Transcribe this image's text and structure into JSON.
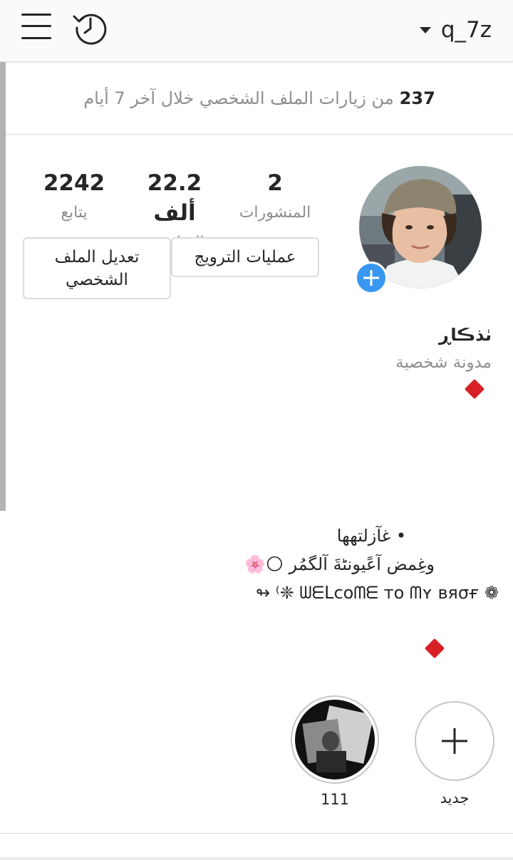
{
  "header": {
    "username": "q_7z",
    "menu_icon": "hamburger-menu-icon",
    "history_icon": "history-clock-icon",
    "dropdown_icon": "caret-down-icon"
  },
  "visits": {
    "count": "237",
    "text": "من زيارات الملف الشخصي خلال آخر 7 أيام"
  },
  "stats": {
    "posts": {
      "value": "2",
      "label": "المنشورات"
    },
    "followers": {
      "value": "22.2 ألف",
      "label": "المتابعون"
    },
    "following": {
      "value": "2242",
      "label": "يتابع"
    }
  },
  "buttons": {
    "promotions": "عمليات الترويج",
    "edit_profile_line1": "تعديل الملف",
    "edit_profile_line2": "الشخصي"
  },
  "bio": {
    "name": "ٺذڪاڕ",
    "category": "مدونة شخصية",
    "line1": "• غآزلتهها",
    "line2": "وغِمض آعًيونٹةَ آلگمُر 🌕🌸",
    "line3": "❁ ᗯᗴᒪcoᗰᗴ ᴛo ᗰʏ ʙяσғ ❈⁾ ↬"
  },
  "highlights": [
    {
      "label": "جديد",
      "icon": "plus-icon"
    },
    {
      "label": "111",
      "icon": "highlight-cover-image"
    }
  ],
  "colors": {
    "accent_blue": "#3897f0",
    "diamond_red": "#d81f26",
    "muted_text": "#8e8e8e",
    "border": "#dbdbdb"
  }
}
